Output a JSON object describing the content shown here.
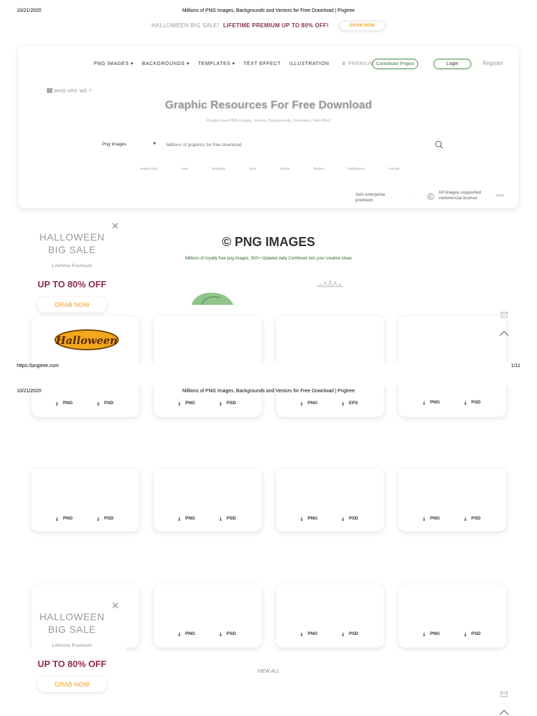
{
  "print_header": {
    "date": "10/21/2020",
    "title": "Millions of PNG Images, Backgrounds and Vectors for Free Download | Pngtree"
  },
  "print_footer": {
    "url": "https://pngtree.com",
    "page": "1/11"
  },
  "promo_bar": {
    "text_gray": "HALLOWEEN BIG SALE!",
    "text_red": "LIFETIME PREMIUM UP TO 80% OFF!",
    "button": "GRAB NOW"
  },
  "nav": {
    "items": [
      "PNG IMAGES ▾",
      "BACKGROUNDS ▾",
      "TEMPLATES ▾",
      "TEXT EFFECT",
      "ILLUSTRATION"
    ],
    "premium": "♛ PREMIUM",
    "contributor": "Contributor Project",
    "login": "Login",
    "register": "Register"
  },
  "hero": {
    "who": "WHO ARE WE ?",
    "headline": "Graphic Resources For Free Download",
    "subline": "Royalty Free PNG Images, Vectors, Backgrounds, Templates, Text Effect",
    "search_type": "Png Images",
    "search_placeholder": "Millions of graphics for free download",
    "tags": [
      "watercolor",
      "tree",
      "birthday",
      "love",
      "frame",
      "flower",
      "halloween",
      "border"
    ],
    "enterprise_line1": "Join enterprise",
    "enterprise_line2": "premium",
    "colon": ":",
    "license_line1": "All images supported",
    "license_line2": "commercial license",
    "arrows": ">>>"
  },
  "side_promo": {
    "close": "✕",
    "title_line1": "HALLOWEEN",
    "title_line2": "BIG SALE",
    "sub": "Lifetime Premium",
    "offer": "UP TO 80% OFF",
    "button": "GRAB NOW",
    "logo_text": "Halloween"
  },
  "png_section": {
    "heading": "© PNG IMAGES",
    "sub": "Millions of royalty free png images, 500+ Updated daily Combined into your creative ideas",
    "view_all": "VIEW ALL",
    "rows": [
      [
        {
          "a": "PNG",
          "b": "PSD"
        },
        {
          "a": "PNG",
          "b": "PSD"
        },
        {
          "a": "PNG",
          "b": "EPS"
        },
        {
          "a": "PNG",
          "b": "PSD"
        }
      ],
      [
        {
          "a": "PNG",
          "b": "PSD"
        },
        {
          "a": "PNG",
          "b": "PSD"
        },
        {
          "a": "PNG",
          "b": "PSD"
        },
        {
          "a": "PNG",
          "b": "PSD"
        }
      ],
      [
        {
          "a": "PNG",
          "b": "PSD"
        },
        {
          "a": "PNG",
          "b": "PSD"
        },
        {
          "a": "PNG",
          "b": "PSD"
        },
        {
          "a": "PNG",
          "b": "PSD"
        }
      ]
    ]
  },
  "colors": {
    "accent_green": "#3f8a3f",
    "promo_red": "#8d2b4f",
    "grab_orange": "#f0a020"
  }
}
